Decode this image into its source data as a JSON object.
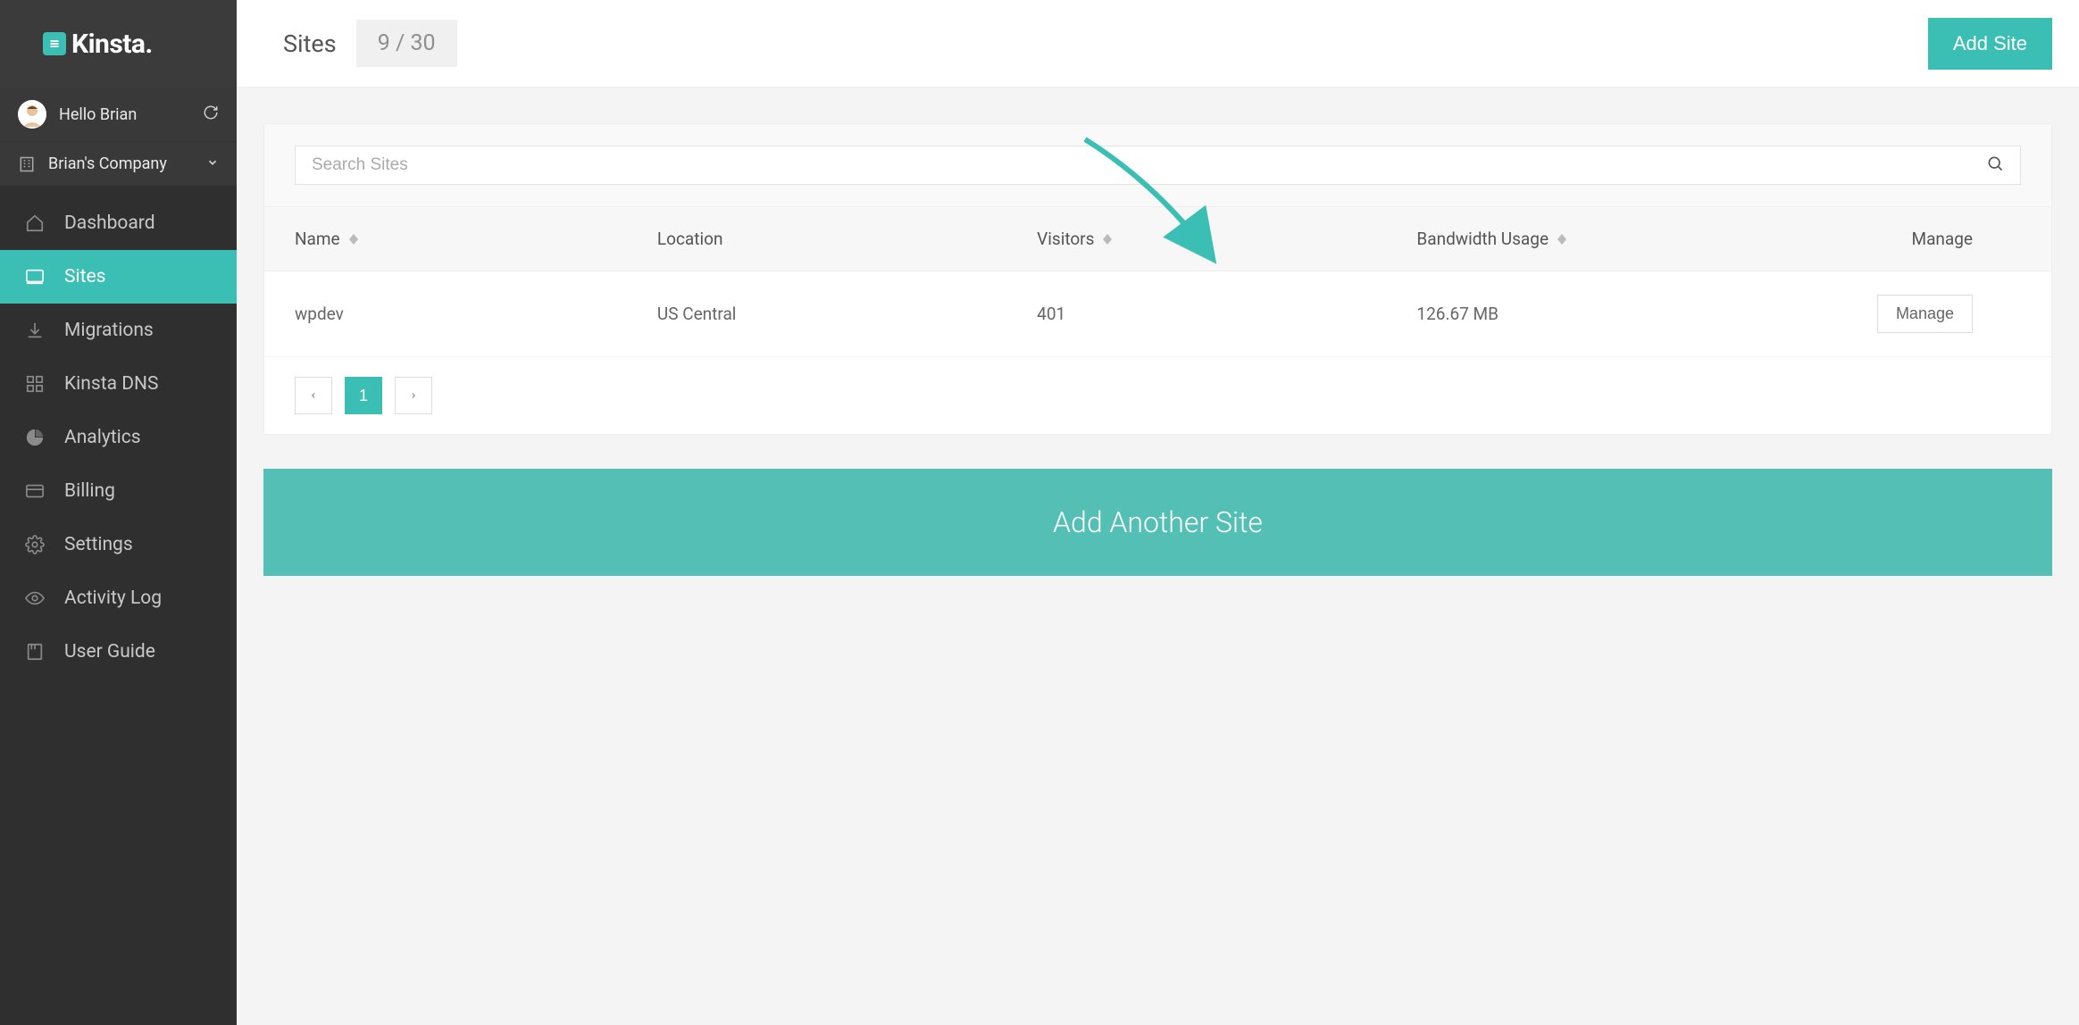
{
  "brand": {
    "name": "Kinsta."
  },
  "user": {
    "greeting": "Hello Brian",
    "company": "Brian's Company"
  },
  "nav": {
    "dashboard": "Dashboard",
    "sites": "Sites",
    "migrations": "Migrations",
    "dns": "Kinsta DNS",
    "analytics": "Analytics",
    "billing": "Billing",
    "settings": "Settings",
    "activity": "Activity Log",
    "guide": "User Guide"
  },
  "header": {
    "title": "Sites",
    "count": "9 / 30",
    "add_button": "Add Site"
  },
  "search": {
    "placeholder": "Search Sites"
  },
  "table": {
    "columns": {
      "name": "Name",
      "location": "Location",
      "visitors": "Visitors",
      "bandwidth": "Bandwidth Usage",
      "manage": "Manage"
    },
    "rows": [
      {
        "name": "wpdev",
        "location": "US Central",
        "visitors": "401",
        "bandwidth": "126.67 MB",
        "manage_label": "Manage"
      }
    ]
  },
  "pagination": {
    "current": "1"
  },
  "big_add_label": "Add Another Site",
  "colors": {
    "accent": "#3bbfb4"
  }
}
